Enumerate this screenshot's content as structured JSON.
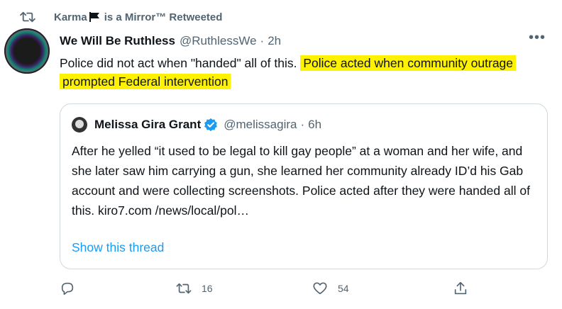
{
  "retweet_bar": {
    "user": "Karma",
    "suffix": "is a Mirror™ Retweeted",
    "icons": [
      "retweet-icon",
      "flag-icon"
    ]
  },
  "tweet": {
    "name": "We Will Be Ruthless",
    "handle": "@RuthlessWe",
    "separator": "·",
    "time": "2h",
    "more_label": "•••",
    "text_plain": "Police did not act when \"handed\" all of this. ",
    "text_highlight": "Police acted when community outrage prompted Federal intervention",
    "highlight_color": "#fff200"
  },
  "quote": {
    "name": "Melissa Gira Grant",
    "verified": true,
    "handle": "@melissagira",
    "separator": "·",
    "time": "6h",
    "text": "After he yelled “it used to be legal to kill gay people” at a woman and her wife, and she later saw him carrying a gun, she learned her community already ID’d his Gab account and were collecting screenshots. Police acted after they were handed all of this. kiro7.com /news/local/pol…",
    "thread_link": "Show this thread",
    "link_color": "#1d9bf0"
  },
  "actions": {
    "reply": {
      "icon": "reply-icon",
      "count": ""
    },
    "retweet": {
      "icon": "retweet-icon",
      "count": "16"
    },
    "like": {
      "icon": "heart-icon",
      "count": "54"
    },
    "share": {
      "icon": "share-icon",
      "count": ""
    }
  }
}
